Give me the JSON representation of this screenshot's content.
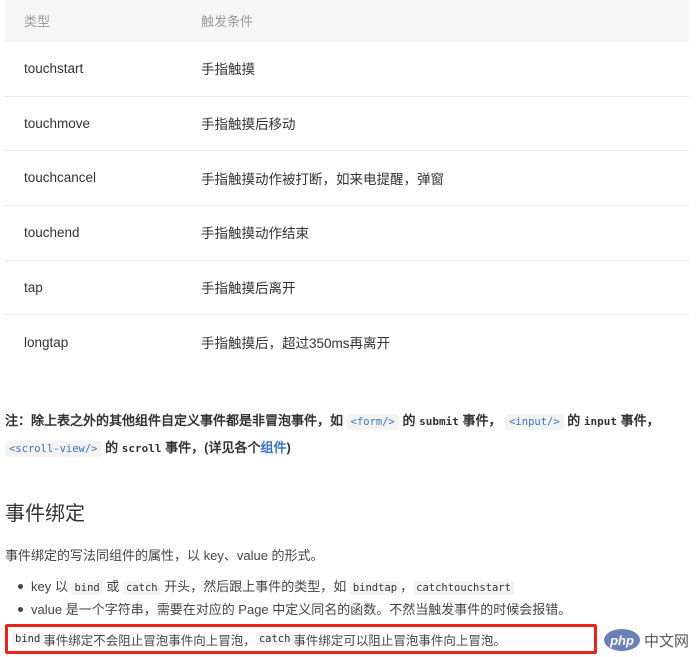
{
  "table": {
    "headers": [
      "类型",
      "触发条件"
    ],
    "rows": [
      {
        "type": "touchstart",
        "trigger": "手指触摸"
      },
      {
        "type": "touchmove",
        "trigger": "手指触摸后移动"
      },
      {
        "type": "touchcancel",
        "trigger": "手指触摸动作被打断，如来电提醒，弹窗"
      },
      {
        "type": "touchend",
        "trigger": "手指触摸动作结束"
      },
      {
        "type": "tap",
        "trigger": "手指触摸后离开"
      },
      {
        "type": "longtap",
        "trigger": "手指触摸后，超过350ms再离开"
      }
    ]
  },
  "note": {
    "prefix": "注：除上表之外的其他组件自定义事件都是非冒泡事件，如 ",
    "form_tag": "<form/>",
    "t1": " 的 ",
    "submit": "submit",
    "t2": " 事件， ",
    "input_tag": "<input/>",
    "t3": " 的 ",
    "input": "input",
    "t4": " 事件， ",
    "scroll_tag": "<scroll-view/>",
    "t5": " 的 ",
    "scroll": "scroll",
    "t6": " 事件，(详见各个",
    "link": "组件",
    "t7": ")"
  },
  "section": {
    "title": "事件绑定",
    "desc": "事件绑定的写法同组件的属性，以 key、value 的形式。"
  },
  "bullets": {
    "b1_pre": "key 以 ",
    "b1_bind": "bind",
    "b1_or": " 或 ",
    "b1_catch": "catch",
    "b1_mid": " 开头，然后跟上事件的类型，如 ",
    "b1_bindtap": "bindtap",
    "b1_comma": "，",
    "b1_cts": "catchtouchstart",
    "b2": "value 是一个字符串，需要在对应的 Page 中定义同名的函数。不然当触发事件的时候会报错。"
  },
  "highlight": {
    "bind": "bind",
    "t1": " 事件绑定不会阻止冒泡事件向上冒泡，  ",
    "catch": "catch",
    "t2": " 事件绑定可以阻止冒泡事件向上冒泡。"
  },
  "watermark": {
    "logo": "php",
    "text": "中文网"
  }
}
